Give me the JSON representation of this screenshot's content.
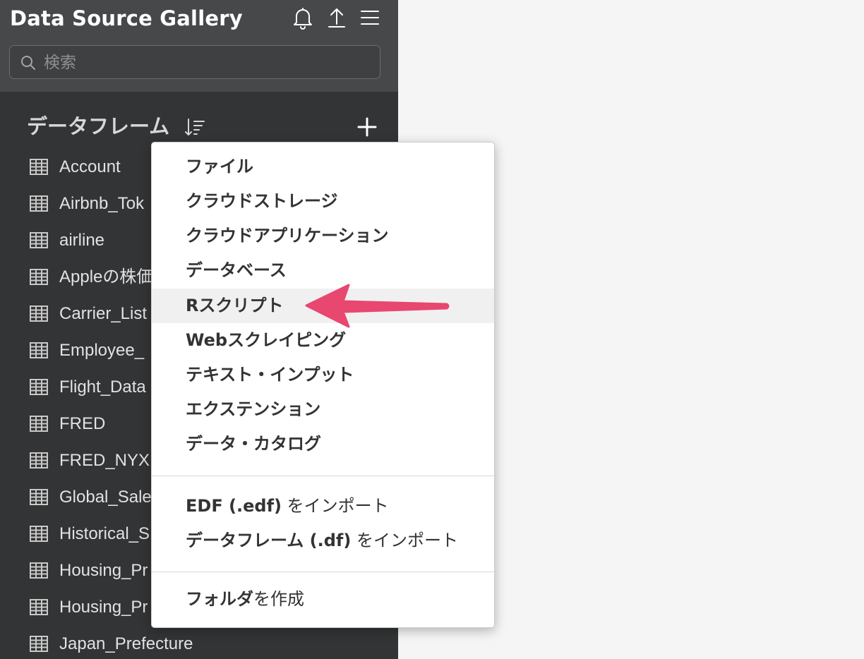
{
  "header": {
    "title": "Data Source Gallery",
    "search_placeholder": "検索"
  },
  "icons": {
    "notifications": "bell-icon",
    "upload": "upload-icon",
    "menu": "hamburger-menu-icon",
    "sort": "sort-icon",
    "add": "plus-icon",
    "table": "table-icon"
  },
  "section": {
    "title": "データフレーム"
  },
  "dataframes": [
    {
      "name": "Account"
    },
    {
      "name": "Airbnb_Tok"
    },
    {
      "name": "airline"
    },
    {
      "name": "Appleの株価"
    },
    {
      "name": "Carrier_List"
    },
    {
      "name": "Employee_"
    },
    {
      "name": "Flight_Data"
    },
    {
      "name": "FRED"
    },
    {
      "name": "FRED_NYX"
    },
    {
      "name": "Global_Sale"
    },
    {
      "name": "Historical_S"
    },
    {
      "name": "Housing_Pr"
    },
    {
      "name": "Housing_Pr"
    },
    {
      "name": "Japan_Prefecture"
    }
  ],
  "menu": {
    "items": [
      {
        "label": "ファイル"
      },
      {
        "label": "クラウドストレージ"
      },
      {
        "label": "クラウドアプリケーション"
      },
      {
        "label": "データベース"
      },
      {
        "label": "Rスクリプト",
        "highlighted": true
      },
      {
        "label": "Webスクレイピング"
      },
      {
        "label": "テキスト・インプット"
      },
      {
        "label": "エクステンション"
      },
      {
        "label": "データ・カタログ"
      }
    ],
    "import_items": [
      {
        "bold": "EDF (.edf)",
        "rest": " をインポート"
      },
      {
        "bold": "データフレーム (.df)",
        "rest": " をインポート"
      }
    ],
    "folder_item": {
      "bold": "フォルダ",
      "rest": "を作成"
    }
  },
  "colors": {
    "sidebar_bg": "#333435",
    "header_bg": "#47484a",
    "highlight_bg": "#f0f0f0",
    "arrow": "#e8476f"
  }
}
